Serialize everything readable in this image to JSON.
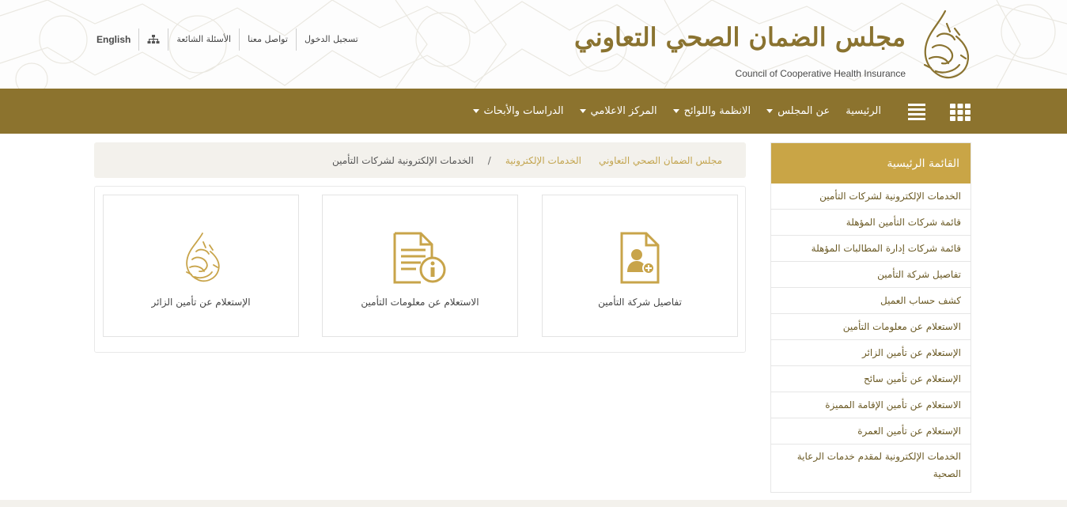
{
  "header": {
    "logo_ar": "مجلس الضمان الصحي التعاوني",
    "logo_en": "Council of Cooperative Health Insurance",
    "toplinks": {
      "login": "تسجيل الدخول",
      "contact": "تواصل معنا",
      "faq": "الأسئلة الشائعة",
      "sitemap_icon": "sitemap-icon",
      "english": "English"
    }
  },
  "nav": {
    "icons": [
      "grid-icon",
      "hamburger-icon"
    ],
    "items": [
      {
        "label": "الرئيسية",
        "dropdown": false
      },
      {
        "label": "عن المجلس",
        "dropdown": true
      },
      {
        "label": "الانظمة واللوائح",
        "dropdown": true
      },
      {
        "label": "المركز الاعلامي",
        "dropdown": true
      },
      {
        "label": "الدراسات والأبحاث",
        "dropdown": true
      }
    ]
  },
  "breadcrumb": {
    "items": [
      "مجلس الضمان الصحي التعاوني",
      "الخدمات الإلكترونية"
    ],
    "separator": "/",
    "current": "الخدمات الإلكترونية لشركات التأمين"
  },
  "sidebar": {
    "title": "القائمة الرئيسية",
    "items": [
      "الخدمات الإلكترونية لشركات التأمين",
      "قائمة شركات التأمين المؤهلة",
      "قائمة شركات إدارة المطالبات المؤهلة",
      "تفاصيل شركة التأمين",
      "كشف حساب العميل",
      "الاستعلام عن معلومات التأمين",
      "الإستعلام عن تأمين الزائر",
      "الإستعلام عن تأمين سائح",
      "الاستعلام عن تأمين الإقامة المميزة",
      "الإستعلام عن تأمين العمرة",
      "الخدمات الإلكترونية لمقدم خدمات الرعاية الصحية"
    ]
  },
  "cards": [
    {
      "label": "تفاصيل شركة التأمين",
      "icon": "document-user-icon"
    },
    {
      "label": "الاستعلام عن معلومات التأمين",
      "icon": "document-info-icon"
    },
    {
      "label": "الإستعلام عن تأمين الزائر",
      "icon": "calligraphy-emblem-icon"
    }
  ],
  "colors": {
    "nav_bg": "#8c732e",
    "sidebar_head": "#c9a546",
    "gold": "#c3a550",
    "breadcrumb_bg": "#f3f1ec"
  }
}
